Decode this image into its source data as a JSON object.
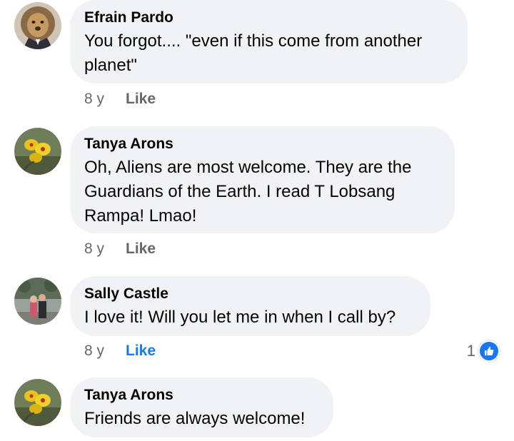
{
  "comments": [
    {
      "author": "Efrain Pardo",
      "lines": [
        "You forgot.... \"even if this come from another",
        "planet\""
      ],
      "time": "8 y",
      "like_label": "Like",
      "avatar_icon": "lion-avatar-icon"
    },
    {
      "author": "Tanya Arons",
      "lines": [
        "Oh, Aliens are most welcome.  They are the",
        "Guardians of the Earth.  I read T Lobsang",
        "Rampa!  Lmao!"
      ],
      "time": "8 y",
      "like_label": "Like",
      "avatar_icon": "yellow-orchid-avatar-icon"
    },
    {
      "author": "Sally Castle",
      "lines": [
        "I love it! Will you let me in when I call by?"
      ],
      "time": "8 y",
      "like_label": "Like",
      "liked": true,
      "reaction_count": "1",
      "avatar_icon": "couple-photo-avatar-icon"
    },
    {
      "author": "Tanya Arons",
      "lines": [
        "Friends are always welcome!"
      ],
      "avatar_icon": "yellow-orchid-avatar-icon"
    }
  ],
  "colors": {
    "bubble": "#f0f2f5",
    "meta_text": "#65676b",
    "like_active": "#1877f2"
  }
}
